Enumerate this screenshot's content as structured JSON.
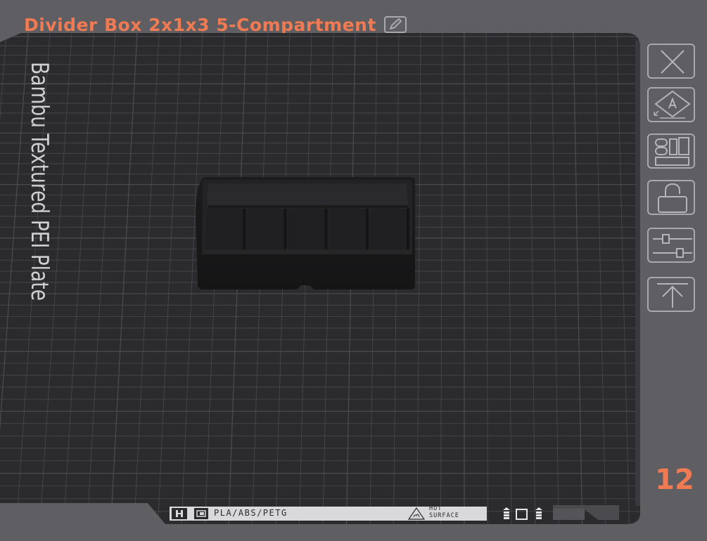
{
  "plate": {
    "title": "Divider Box 2x1x3 5-Compartment",
    "bed_label": "Bambu Textured PEI Plate",
    "number": "12"
  },
  "footer": {
    "materials": "PLA/ABS/PETG",
    "hot_surface_line1": "HOT",
    "hot_surface_line2": "SURFACE"
  },
  "object": {
    "compartments": 5
  },
  "toolbar": {
    "buttons": [
      {
        "name": "remove-plate-button",
        "icon": "close-icon"
      },
      {
        "name": "auto-orient-button",
        "icon": "auto-orient-icon"
      },
      {
        "name": "arrange-button",
        "icon": "arrange-icon"
      },
      {
        "name": "lock-plate-button",
        "icon": "lock-icon"
      },
      {
        "name": "plate-settings-button",
        "icon": "sliders-icon"
      },
      {
        "name": "move-to-top-button",
        "icon": "move-top-icon"
      }
    ]
  },
  "colors": {
    "accent": "#f07a52",
    "background": "#5e5e63",
    "bed": "#2b2b2d",
    "grid": "#4a4a4f"
  }
}
